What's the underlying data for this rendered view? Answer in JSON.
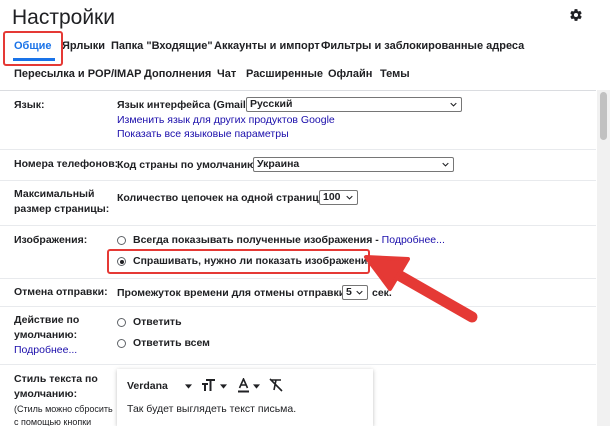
{
  "page": {
    "title": "Настройки"
  },
  "tabs_row1": [
    "Общие",
    "Ярлыки",
    "Папка \"Входящие\"",
    "Аккаунты и импорт",
    "Фильтры и заблокированные адреса"
  ],
  "tabs_row2": [
    "Пересылка и POP/IMAP",
    "Дополнения",
    "Чат",
    "Расширенные",
    "Офлайн",
    "Темы"
  ],
  "language": {
    "label": "Язык:",
    "interface_label": "Язык интерфейса (Gmail):",
    "interface_value": "Русский",
    "link1": "Изменить язык для других продуктов Google",
    "link2": "Показать все языковые параметры"
  },
  "phone": {
    "label": "Номера телефонов:",
    "country_label": "Код страны по умолчанию:",
    "country_value": "Украина"
  },
  "page_size": {
    "label_line1": "Максимальный",
    "label_line2": "размер страницы:",
    "threads_label": "Количество цепочек на одной странице:",
    "threads_value": "100"
  },
  "images": {
    "label": "Изображения:",
    "option1": "Всегда показывать полученные изображения - ",
    "option1_link": "Подробнее...",
    "option2": "Спрашивать, нужно ли показать изображения",
    "selected": "option2"
  },
  "undo_send": {
    "label": "Отмена отправки:",
    "period_label": "Промежуток времени для отмены отправки:",
    "period_value": "5",
    "unit": "сек."
  },
  "default_action": {
    "label_line1": "Действие по",
    "label_line2": "умолчанию:",
    "link": "Подробнее...",
    "option1": "Ответить",
    "option2": "Ответить всем"
  },
  "text_style": {
    "label_line1": "Стиль текста по",
    "label_line2": "умолчанию:",
    "note_line1": "(Стиль можно сбросить",
    "note_line2": "с помощью кнопки",
    "font": "Verdana",
    "sample": "Так будет выглядеть текст письма."
  },
  "colors": {
    "accent": "#1a73e8",
    "highlight": "#e53935",
    "link": "#1a0dab"
  }
}
